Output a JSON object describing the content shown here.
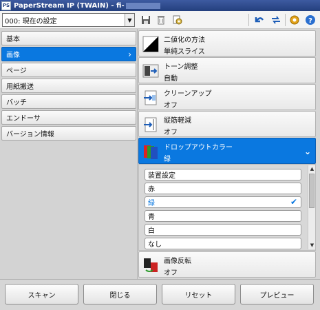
{
  "window": {
    "app_icon": "PS",
    "title": "PaperStream IP (TWAIN) - fi-"
  },
  "toolbar": {
    "profile_value": "000: 現在の設定",
    "icons": [
      "save-icon",
      "delete-icon",
      "profile-manage-icon",
      "undo-icon",
      "swap-icon",
      "settings-gear-icon",
      "help-icon"
    ]
  },
  "nav": {
    "items": [
      {
        "label": "基本"
      },
      {
        "label": "画像",
        "active": true
      },
      {
        "label": "ページ"
      },
      {
        "label": "用紙搬送"
      },
      {
        "label": "バッチ"
      },
      {
        "label": "エンドーサ"
      },
      {
        "label": "バージョン情報"
      }
    ]
  },
  "settings": {
    "binarize": {
      "title": "二値化の方法",
      "value": "単純スライス"
    },
    "tone": {
      "title": "トーン調整",
      "value": "自動"
    },
    "cleanup": {
      "title": "クリーンアップ",
      "value": "オフ"
    },
    "stripe": {
      "title": "縦筋軽減",
      "value": "オフ"
    },
    "dropout": {
      "title": "ドロップアウトカラー",
      "value": "緑"
    },
    "invert": {
      "title": "画像反転",
      "value": "オフ"
    }
  },
  "dropout_options": [
    {
      "label": "装置設定"
    },
    {
      "label": "赤"
    },
    {
      "label": "緑",
      "selected": true
    },
    {
      "label": "青"
    },
    {
      "label": "白"
    },
    {
      "label": "なし"
    }
  ],
  "footer": {
    "scan": "スキャン",
    "close": "閉じる",
    "reset": "リセット",
    "preview": "プレビュー"
  },
  "colors": {
    "accent": "#0a78e0",
    "titlebar": "#24407e"
  }
}
